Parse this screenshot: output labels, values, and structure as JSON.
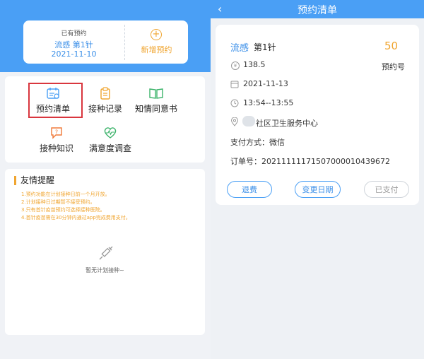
{
  "left_panel": {
    "appointment_card": {
      "existing_label": "已有预约",
      "vaccine_dose": "流感 第1针",
      "date": "2021-11-10",
      "plus_symbol": "+",
      "new_appointment": "新增预约"
    },
    "menu": {
      "items": [
        "预约清单",
        "接种记录",
        "知情同意书",
        "接种知识",
        "满意度调查"
      ]
    },
    "tips": {
      "title": "友情提醒",
      "lines": [
        "1.预约功能在计划接种日前一个月开放。",
        "2.计划接种日过期暂不接受预约。",
        "3.只有首针疫苗预约可选择接种医院。",
        "4.首针疫苗需在30分钟内通过app完成费用支付。"
      ],
      "empty_text": "暂无计划接种~"
    }
  },
  "right_panel": {
    "header": {
      "back_icon": "‹",
      "title": "预约清单"
    },
    "order": {
      "vaccine": "流感",
      "dose": "第1针",
      "number": "50",
      "number_label": "预约号",
      "price": "138.5",
      "date": "2021-11-13",
      "time": "13:54--13:55",
      "location": "社区卫生服务中心",
      "payment_method": "支付方式：微信",
      "order_no": "订单号：20211111171507000010439672",
      "buttons": {
        "refund": "退费",
        "change_date": "变更日期",
        "paid": "已支付"
      }
    }
  },
  "colors": {
    "primary": "#4a9ff5",
    "accent_orange": "#f0a530",
    "highlight_red": "#d9363e"
  }
}
